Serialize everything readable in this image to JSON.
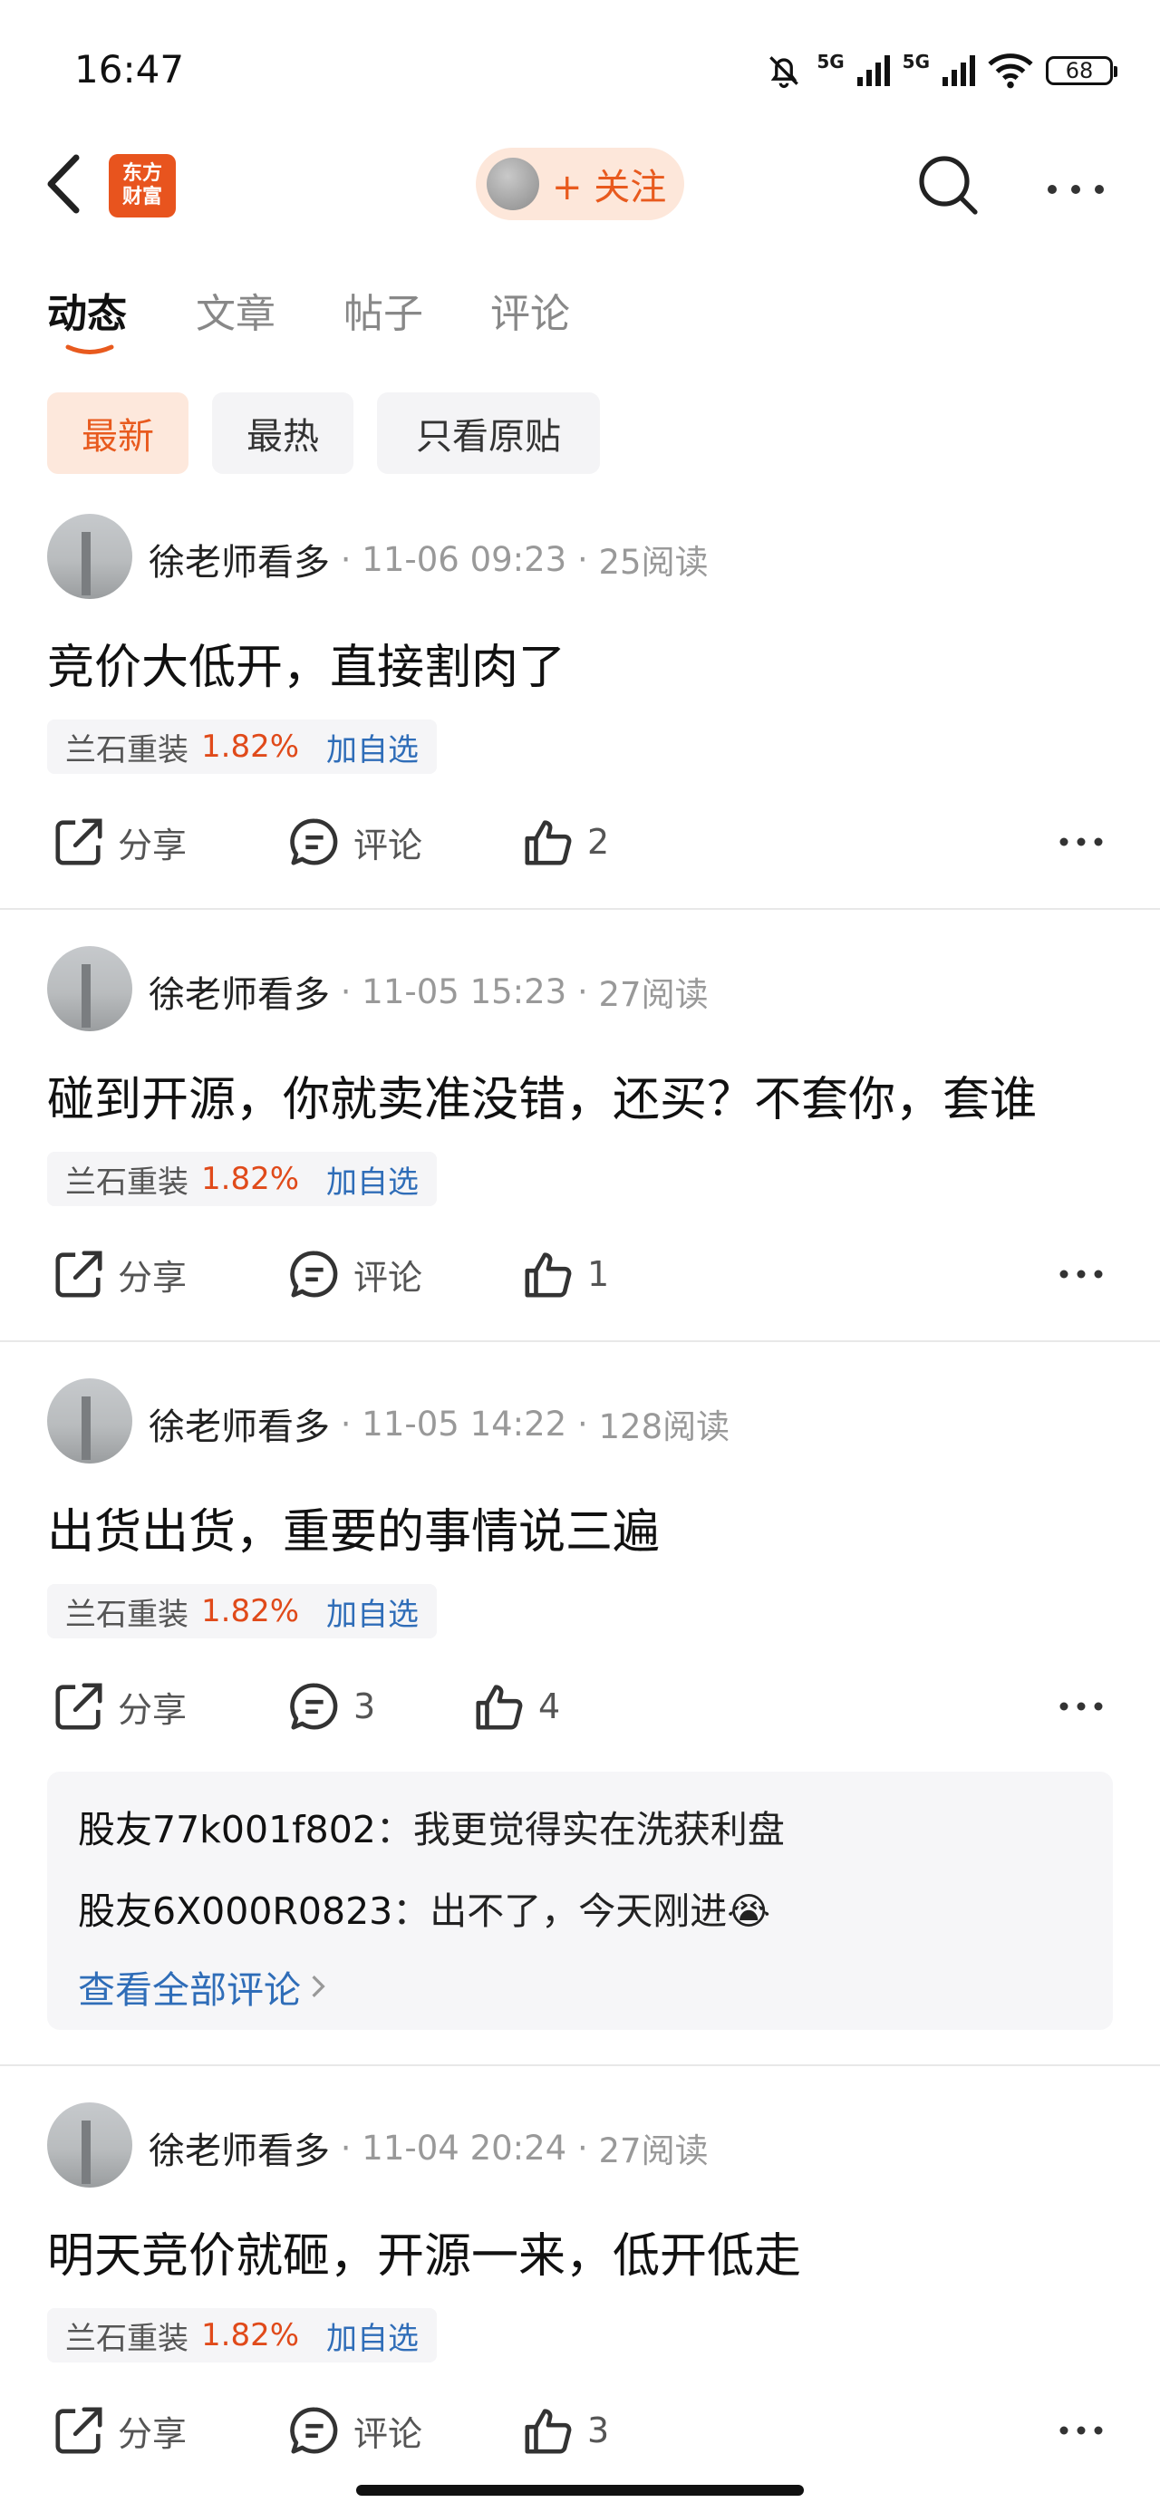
{
  "status_bar": {
    "time": "16:47",
    "battery": "68",
    "network_1": "5G",
    "network_2": "5G"
  },
  "header": {
    "logo_text": "东方财富",
    "follow_label": "+ 关注"
  },
  "tabs": [
    {
      "label": "动态",
      "active": true
    },
    {
      "label": "文章",
      "active": false
    },
    {
      "label": "帖子",
      "active": false
    },
    {
      "label": "评论",
      "active": false
    }
  ],
  "filters": [
    {
      "label": "最新",
      "active": true
    },
    {
      "label": "最热",
      "active": false
    },
    {
      "label": "只看原贴",
      "active": false
    }
  ],
  "posts": [
    {
      "author": "徐老师看多",
      "time": "11-06 09:23",
      "reads": "25阅读",
      "content": "竞价大低开，直接割肉了",
      "stock": {
        "name": "兰石重装",
        "change": "1.82%",
        "add": "加自选"
      },
      "share": "分享",
      "comment": "评论",
      "likes": "2"
    },
    {
      "author": "徐老师看多",
      "time": "11-05 15:23",
      "reads": "27阅读",
      "content": "碰到开源，你就卖准没错，还买？不套你，套谁",
      "stock": {
        "name": "兰石重装",
        "change": "1.82%",
        "add": "加自选"
      },
      "share": "分享",
      "comment": "评论",
      "likes": "1"
    },
    {
      "author": "徐老师看多",
      "time": "11-05 14:22",
      "reads": "128阅读",
      "content": "出货出货，重要的事情说三遍",
      "stock": {
        "name": "兰石重装",
        "change": "1.82%",
        "add": "加自选"
      },
      "share": "分享",
      "comment": "3",
      "likes": "4",
      "comments": [
        {
          "user": "股友77k001f802",
          "text": "我更觉得实在洗获利盘"
        },
        {
          "user": "股友6X000R0823",
          "text": "出不了，今天刚进😭"
        }
      ],
      "view_all": "查看全部评论"
    },
    {
      "author": "徐老师看多",
      "time": "11-04 20:24",
      "reads": "27阅读",
      "content": "明天竞价就砸，开源一来，低开低走",
      "stock": {
        "name": "兰石重装",
        "change": "1.82%",
        "add": "加自选"
      },
      "share": "分享",
      "comment": "评论",
      "likes": "3"
    }
  ],
  "colors": {
    "accent": "#e85a1e",
    "link": "#2f6db8",
    "up": "#e04a1a"
  }
}
